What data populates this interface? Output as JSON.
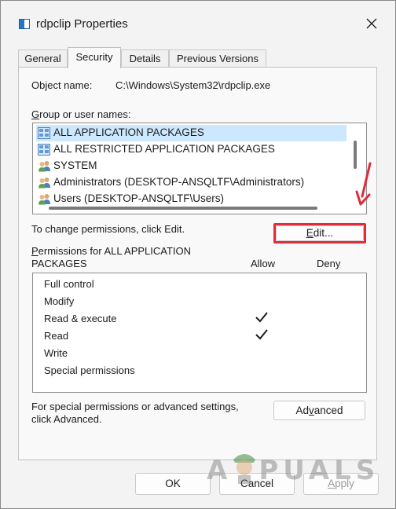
{
  "window": {
    "title": "rdpclip Properties",
    "close_glyph": "✕"
  },
  "tabs": [
    {
      "label": "General"
    },
    {
      "label": "Security"
    },
    {
      "label": "Details"
    },
    {
      "label": "Previous Versions"
    }
  ],
  "security": {
    "object_name_label": "Object name:",
    "object_name_value": "C:\\Windows\\System32\\rdpclip.exe",
    "group_label_accel": "G",
    "group_label_rest": "roup or user names:",
    "users": [
      {
        "name": "ALL APPLICATION PACKAGES",
        "icon": "app-package-icon"
      },
      {
        "name": "ALL RESTRICTED APPLICATION PACKAGES",
        "icon": "app-package-icon"
      },
      {
        "name": "SYSTEM",
        "icon": "user-group-icon"
      },
      {
        "name": "Administrators (DESKTOP-ANSQLTF\\Administrators)",
        "icon": "user-group-icon"
      },
      {
        "name": "Users (DESKTOP-ANSQLTF\\Users)",
        "icon": "user-group-icon"
      }
    ],
    "change_text": "To change permissions, click Edit.",
    "edit_button_accel": "E",
    "edit_button_rest": "dit...",
    "permissions_accel": "P",
    "permissions_line1_rest": "ermissions for ALL APPLICATION",
    "permissions_line2": "PACKAGES",
    "allow_header": "Allow",
    "deny_header": "Deny",
    "permissions": [
      {
        "name": "Full control",
        "allow": false,
        "deny": false
      },
      {
        "name": "Modify",
        "allow": false,
        "deny": false
      },
      {
        "name": "Read & execute",
        "allow": true,
        "deny": false
      },
      {
        "name": "Read",
        "allow": true,
        "deny": false
      },
      {
        "name": "Write",
        "allow": false,
        "deny": false
      },
      {
        "name": "Special permissions",
        "allow": false,
        "deny": false
      }
    ],
    "special_text_line1": "For special permissions or advanced settings,",
    "special_text_line2": "click Advanced.",
    "advanced_button_pre": "Ad",
    "advanced_button_accel": "v",
    "advanced_button_post": "anced"
  },
  "footer": {
    "ok": "OK",
    "cancel": "Cancel",
    "apply_accel": "A",
    "apply_rest": "pply"
  },
  "watermark": {
    "text_pre": "A",
    "text_post": "PUALS"
  },
  "colors": {
    "highlight": "#e02b3b",
    "selection": "#cce8ff"
  }
}
